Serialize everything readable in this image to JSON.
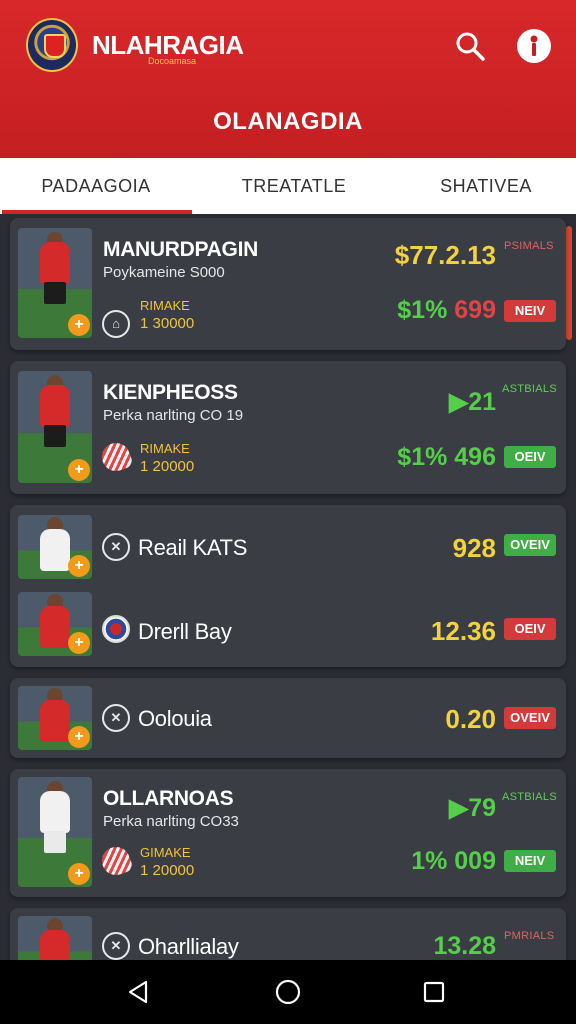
{
  "header": {
    "brand": "NLAHRAGIA",
    "brand_sub": "Docoamasa",
    "title": "OLANAGDIA"
  },
  "tabs": [
    {
      "label": "PADAAGOIA"
    },
    {
      "label": "TREATATLE"
    },
    {
      "label": "SHATIVEA"
    }
  ],
  "cards": [
    {
      "name": "MANURDPAGIN",
      "sub": "Poykameine S000",
      "rimake_label": "RIMAKE",
      "rimake_value": "1 30000",
      "price": "$77.2.13",
      "tag": "PSIMALS",
      "price2_green": "$1%",
      "price2_red": "699",
      "button": "NEIV"
    },
    {
      "name": "KIENPHEOSS",
      "sub": "Perka narlting CO 19",
      "rimake_label": "RIMAKE",
      "rimake_value": "1 20000",
      "price": "21",
      "tag": "ASTBIALS",
      "price2": "$1% 496",
      "button": "OEIV"
    },
    {
      "name": "Reail KATS",
      "price": "928",
      "button": "OVEIV"
    },
    {
      "name": "Drerll Bay",
      "price": "12.36",
      "button": "OEIV"
    },
    {
      "name": "Oolouia",
      "price": "0.20",
      "button": "OVEIV"
    },
    {
      "name": "OLLARNOAS",
      "sub": "Perka narlting CO33",
      "rimake_label": "GIMAKE",
      "rimake_value": "1 20000",
      "price": "79",
      "tag": "ASTBIALS",
      "price2": "1% 009",
      "button": "NEIV"
    },
    {
      "name": "Oharllialay",
      "price": "13.28",
      "tag": "PMRIALS"
    }
  ],
  "colors": {
    "header_red": "#c41f22",
    "accent_green": "#55cf4a",
    "accent_yellow": "#f4d23d",
    "button_red": "#d33a3a",
    "button_green": "#3fae47"
  },
  "icons": {
    "search": "search-icon",
    "info": "info-icon",
    "back": "back-icon",
    "home": "home-icon",
    "recents": "recents-icon"
  }
}
